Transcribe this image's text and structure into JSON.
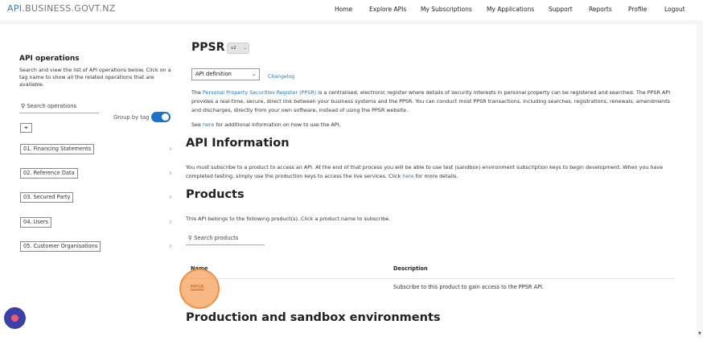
{
  "brand": {
    "part1": "API.",
    "part2": "BUSINESS.GOVT.NZ"
  },
  "nav": [
    "Home",
    "Explore APIs",
    "My Subscriptions",
    "My Applications",
    "Support",
    "Reports",
    "Profile",
    "Logout"
  ],
  "sidebar": {
    "title": "API operations",
    "description": "Search and view the list of API operations below. Click on a tag name to show all the related operations that are available.",
    "search_placeholder": "Search operations",
    "group_by_label": "Group by tag",
    "group_by_enabled": true,
    "tags": [
      "01. Financing Statements",
      "02. Reference Data",
      "03. Secured Party",
      "04. Users",
      "05. Customer Organisations"
    ]
  },
  "main": {
    "title": "PPSR",
    "version": "v2",
    "api_select": "API definition",
    "changelog": "Changelog",
    "intro_before": "The ",
    "intro_link": "Personal Property Securities Register (PPSR)",
    "intro_after": " is a centralised, electronic register where details of security interests in personal property can be registered and searched. The PPSR API provides a real-time, secure, direct link between your business systems and the PPSR. You can conduct most PPSR transactions, including searches, registrations, renewals, amendments and discharges, directly from your own software, instead of using the PPSR website.",
    "see_before": "See ",
    "see_link": "here",
    "see_after": " for additional information on how to use the API.",
    "api_info_heading": "API Information",
    "api_info_before": "You must subscribe to a product to access an API. At the end of that process you will be able to use test (sandbox) environment subscription keys to begin development. When you have completed testing, simply use the production keys to access the live services. Click ",
    "api_info_link": "here",
    "api_info_after": " for more details.",
    "products_heading": "Products",
    "products_desc": "This API belongs to the following product(s). Click a product name to subscribe.",
    "products_search_placeholder": "Search products",
    "table": {
      "headers": [
        "Name",
        "Description"
      ],
      "rows": [
        {
          "name": "PPSR",
          "description": "Subscribe to this product to gain access to the PPSR API."
        }
      ]
    },
    "prod_heading": "Production and sandbox environments"
  },
  "colors": {
    "accent": "#1a73c8",
    "link": "#2a7ab8",
    "highlight": "#f5a05a",
    "recorder": "#3b3fa8"
  },
  "icons": {
    "search": "search-icon",
    "filter": "filter-icon",
    "chevron": "chevron-right-icon",
    "record": "record-icon"
  }
}
